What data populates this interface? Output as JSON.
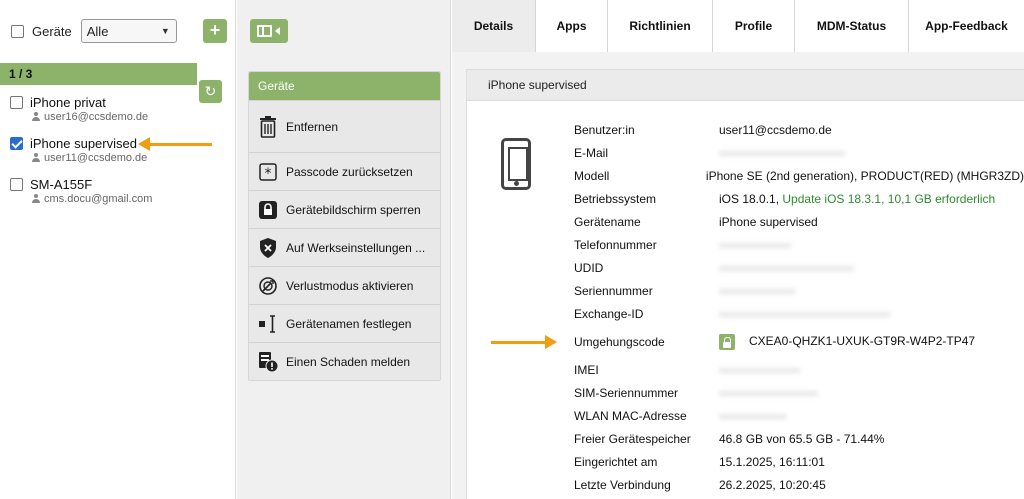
{
  "filter": {
    "label": "Geräte",
    "selected": "Alle"
  },
  "device_list": {
    "count": "1 / 3",
    "items": [
      {
        "name": "iPhone privat",
        "user": "user16@ccsdemo.de",
        "checked": false
      },
      {
        "name": "iPhone supervised",
        "user": "user11@ccsdemo.de",
        "checked": true
      },
      {
        "name": "SM-A155F",
        "user": "cms.docu@gmail.com",
        "checked": false
      }
    ]
  },
  "actions": {
    "header": "Geräte",
    "items": [
      {
        "label": "Entfernen",
        "icon": "trash-icon"
      },
      {
        "label": "Passcode zurücksetzen",
        "icon": "asterisk-icon"
      },
      {
        "label": "Gerätebildschirm sperren",
        "icon": "lock-icon"
      },
      {
        "label": "Auf Werkseinstellungen ...",
        "icon": "shield-x-icon"
      },
      {
        "label": "Verlustmodus aktivieren",
        "icon": "lost-mode-icon"
      },
      {
        "label": "Gerätenamen festlegen",
        "icon": "rename-icon"
      },
      {
        "label": "Einen Schaden melden",
        "icon": "damage-report-icon"
      }
    ]
  },
  "tabs": [
    "Details",
    "Apps",
    "Richtlinien",
    "Profile",
    "MDM-Status",
    "App-Feedback"
  ],
  "active_tab": "Details",
  "detail": {
    "title": "iPhone supervised",
    "props": [
      {
        "key": "Benutzer:in",
        "value": "user11@ccsdemo.de"
      },
      {
        "key": "E-Mail",
        "value": ""
      },
      {
        "key": "Modell",
        "value": "iPhone SE (2nd generation), PRODUCT(RED) (MHGR3ZD)"
      },
      {
        "key": "Betriebssystem",
        "value": "iOS 18.0.1, ",
        "update": "Update iOS 18.3.1, 10,1 GB erforderlich"
      },
      {
        "key": "Gerätename",
        "value": "iPhone supervised"
      },
      {
        "key": "Telefonnummer",
        "value": ""
      },
      {
        "key": "UDID",
        "value": ""
      },
      {
        "key": "Seriennummer",
        "value": ""
      },
      {
        "key": "Exchange-ID",
        "value": ""
      },
      {
        "key": "Umgehungscode",
        "value": "CXEA0-QHZK1-UXUK-GT9R-W4P2-TP47"
      },
      {
        "key": "IMEI",
        "value": ""
      },
      {
        "key": "SIM-Seriennummer",
        "value": ""
      },
      {
        "key": "WLAN MAC-Adresse",
        "value": ""
      },
      {
        "key": "Freier Gerätespeicher",
        "value": "46.8 GB von 65.5 GB - 71.44%"
      },
      {
        "key": "Eingerichtet am",
        "value": "15.1.2025, 16:11:01"
      },
      {
        "key": "Letzte Verbindung",
        "value": "26.2.2025, 10:20:45"
      }
    ]
  },
  "colors": {
    "accent": "#8db26a",
    "arrow": "#f39c12",
    "update_text": "#2e8b2e",
    "checkbox": "#2a6ccf"
  }
}
